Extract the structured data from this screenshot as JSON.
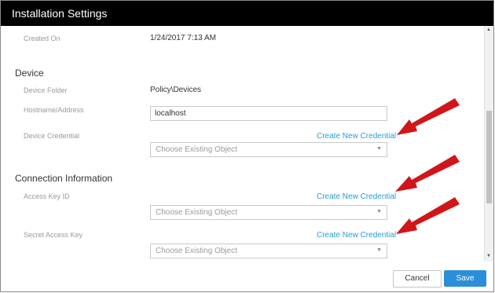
{
  "dialog": {
    "title": "Installation Settings"
  },
  "general": {
    "created_on_label": "Created On",
    "created_on_value": "1/24/2017 7:13 AM"
  },
  "device": {
    "heading": "Device",
    "folder_label": "Device Folder",
    "folder_value": "Policy\\Devices",
    "hostname_label": "Hostname/Address",
    "hostname_value": "localhost",
    "credential_label": "Device Credential",
    "credential_link": "Create New Credential",
    "credential_placeholder": "Choose Existing Object"
  },
  "connection": {
    "heading": "Connection Information",
    "access_key_label": "Access Key ID",
    "access_key_link": "Create New Credential",
    "access_key_placeholder": "Choose Existing Object",
    "secret_key_label": "Secret Access Key",
    "secret_key_link": "Create New Credential",
    "secret_key_placeholder": "Choose Existing Object"
  },
  "footer": {
    "cancel_label": "Cancel",
    "save_label": "Save"
  },
  "colors": {
    "accent": "#2a8fd8",
    "link": "#2a9bd6",
    "annotation_arrow": "#d0161b",
    "titlebar": "#000000"
  },
  "icons": {
    "dropdown": "caret-down-icon",
    "scroll_up": "triangle-up-icon",
    "scroll_down": "triangle-down-icon",
    "annotation": "red-arrow-icon"
  }
}
